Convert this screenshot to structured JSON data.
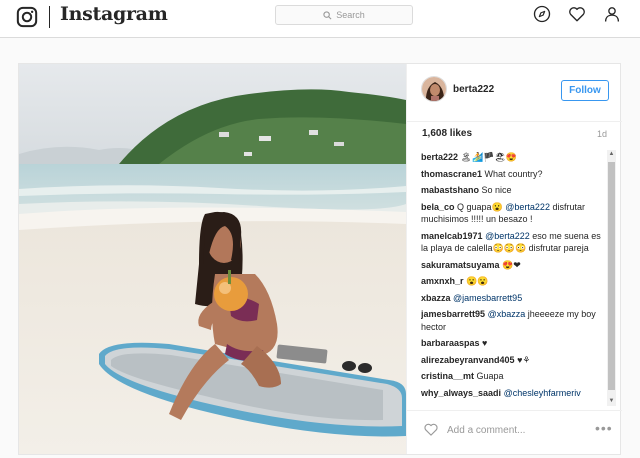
{
  "topbar": {
    "wordmark": "Instagram",
    "search_placeholder": "Search",
    "icons": [
      "instagram-logo-icon",
      "search-icon",
      "explore-compass-icon",
      "heart-activity-icon",
      "profile-icon"
    ]
  },
  "post": {
    "username": "berta222",
    "follow_label": "Follow",
    "likes": "1,608 likes",
    "age": "1d",
    "add_comment_placeholder": "Add a comment...",
    "more_label": "•••",
    "comments": [
      {
        "user": "berta222",
        "parts": [
          {
            "t": "text",
            "v": " 🏝🏄🏴🏖😍"
          }
        ]
      },
      {
        "user": "thomascrane1",
        "parts": [
          {
            "t": "text",
            "v": " What country?"
          }
        ]
      },
      {
        "user": "mabastshano",
        "parts": [
          {
            "t": "text",
            "v": " So nice"
          }
        ]
      },
      {
        "user": "bela_co",
        "parts": [
          {
            "t": "text",
            "v": " Q guapa😮 "
          },
          {
            "t": "mention",
            "v": "@berta222"
          },
          {
            "t": "text",
            "v": " disfrutar muchisimos !!!!! un besazo !"
          }
        ]
      },
      {
        "user": "manelcab1971",
        "parts": [
          {
            "t": "text",
            "v": " "
          },
          {
            "t": "mention",
            "v": "@berta222"
          },
          {
            "t": "text",
            "v": " eso me suena es la playa de calella😳😳😳 disfrutar pareja"
          }
        ]
      },
      {
        "user": "sakuramatsuyama",
        "parts": [
          {
            "t": "text",
            "v": " 😍❤"
          }
        ]
      },
      {
        "user": "amxnxh_r",
        "parts": [
          {
            "t": "text",
            "v": " 😮😮"
          }
        ]
      },
      {
        "user": "xbazza",
        "parts": [
          {
            "t": "text",
            "v": " "
          },
          {
            "t": "mention",
            "v": "@jamesbarrett95"
          }
        ]
      },
      {
        "user": "jamesbarrett95",
        "parts": [
          {
            "t": "text",
            "v": " "
          },
          {
            "t": "mention",
            "v": "@xbazza"
          },
          {
            "t": "text",
            "v": " jheeeeze my boy hector"
          }
        ]
      },
      {
        "user": "barbaraaspas",
        "parts": [
          {
            "t": "text",
            "v": " ♥"
          }
        ]
      },
      {
        "user": "alirezabeyranvand405",
        "parts": [
          {
            "t": "text",
            "v": " ♥⚘"
          }
        ]
      },
      {
        "user": "cristina__mt",
        "parts": [
          {
            "t": "text",
            "v": " Guapa"
          }
        ]
      },
      {
        "user": "why_always_saadi",
        "parts": [
          {
            "t": "text",
            "v": " "
          },
          {
            "t": "mention",
            "v": "@chesleyhfarmeriv"
          }
        ]
      }
    ]
  },
  "colors": {
    "link_blue": "#3897f0",
    "mention": "#003569",
    "border": "#dbdbdb",
    "background": "#fafafa"
  }
}
